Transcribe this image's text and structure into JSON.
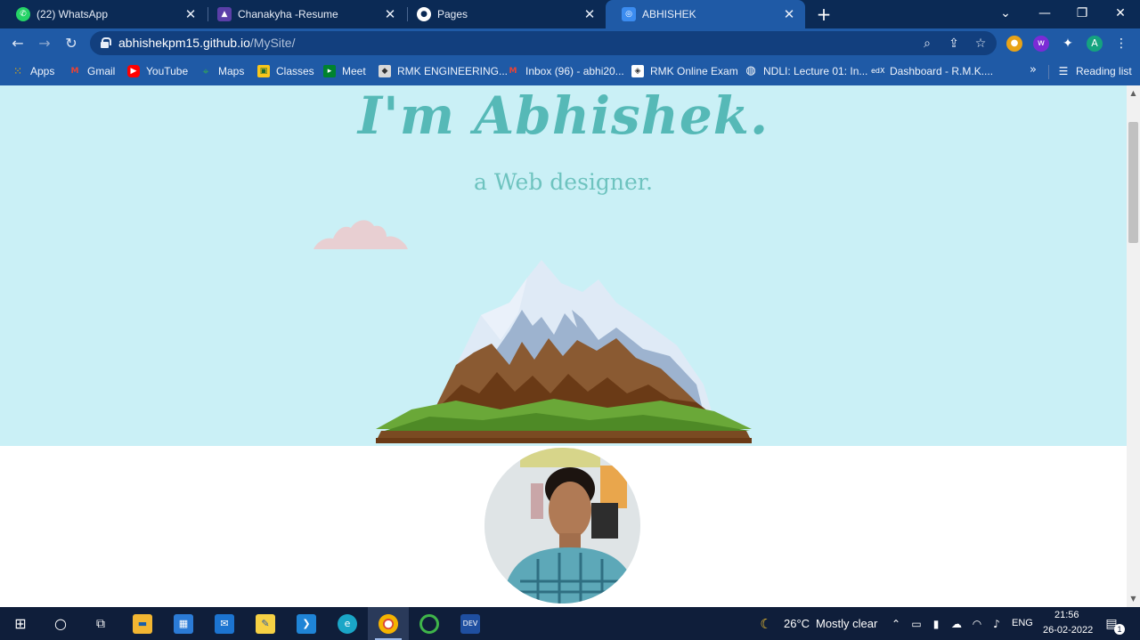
{
  "browser": {
    "tabs": [
      {
        "label": "(22) WhatsApp",
        "icon": "whatsapp-icon",
        "active": false
      },
      {
        "label": "Chanakyha -Resume",
        "icon": "resume-icon",
        "active": false
      },
      {
        "label": "Pages",
        "icon": "github-icon",
        "active": false
      },
      {
        "label": "ABHISHEK",
        "icon": "site-icon",
        "active": true
      }
    ],
    "tab_close_glyph": "✕",
    "new_tab_glyph": "+",
    "url_host": "abhishekpm15.github.io",
    "url_path": "/MySite/",
    "profile_initial": "A",
    "accent_color": "#1f5aa6"
  },
  "bookmarks": [
    {
      "label": "Apps",
      "icon": "apps-grid-icon"
    },
    {
      "label": "Gmail",
      "icon": "gmail-icon"
    },
    {
      "label": "YouTube",
      "icon": "youtube-icon"
    },
    {
      "label": "Maps",
      "icon": "maps-icon"
    },
    {
      "label": "Classes",
      "icon": "classroom-icon"
    },
    {
      "label": "Meet",
      "icon": "meet-icon"
    },
    {
      "label": "RMK ENGINEERING...",
      "icon": "rmk-icon"
    },
    {
      "label": "Inbox (96) - abhi20...",
      "icon": "gmail-icon"
    },
    {
      "label": "RMK Online Exam",
      "icon": "exam-icon"
    },
    {
      "label": "NDLI: Lecture 01: In...",
      "icon": "globe-icon"
    },
    {
      "label": "Dashboard - R.M.K....",
      "icon": "edx-icon"
    }
  ],
  "reading_list": "Reading list",
  "page": {
    "headline": "I'm Abhishek.",
    "subheadline": "a Web designer.",
    "hero_color": "#caf0f6",
    "text_color": "#56b9b7"
  },
  "taskbar": {
    "weather_temp": "26°C",
    "weather_text": "Mostly clear",
    "language": "ENG",
    "time": "21:56",
    "date": "26-02-2022",
    "notification_count": "1",
    "apps": [
      "start-icon",
      "search-icon",
      "task-view-icon",
      "file-explorer-icon",
      "store-icon",
      "mail-icon",
      "sticky-notes-icon",
      "vscode-icon",
      "edge-icon",
      "chrome-icon",
      "circle-app-icon",
      "devc-icon"
    ]
  }
}
